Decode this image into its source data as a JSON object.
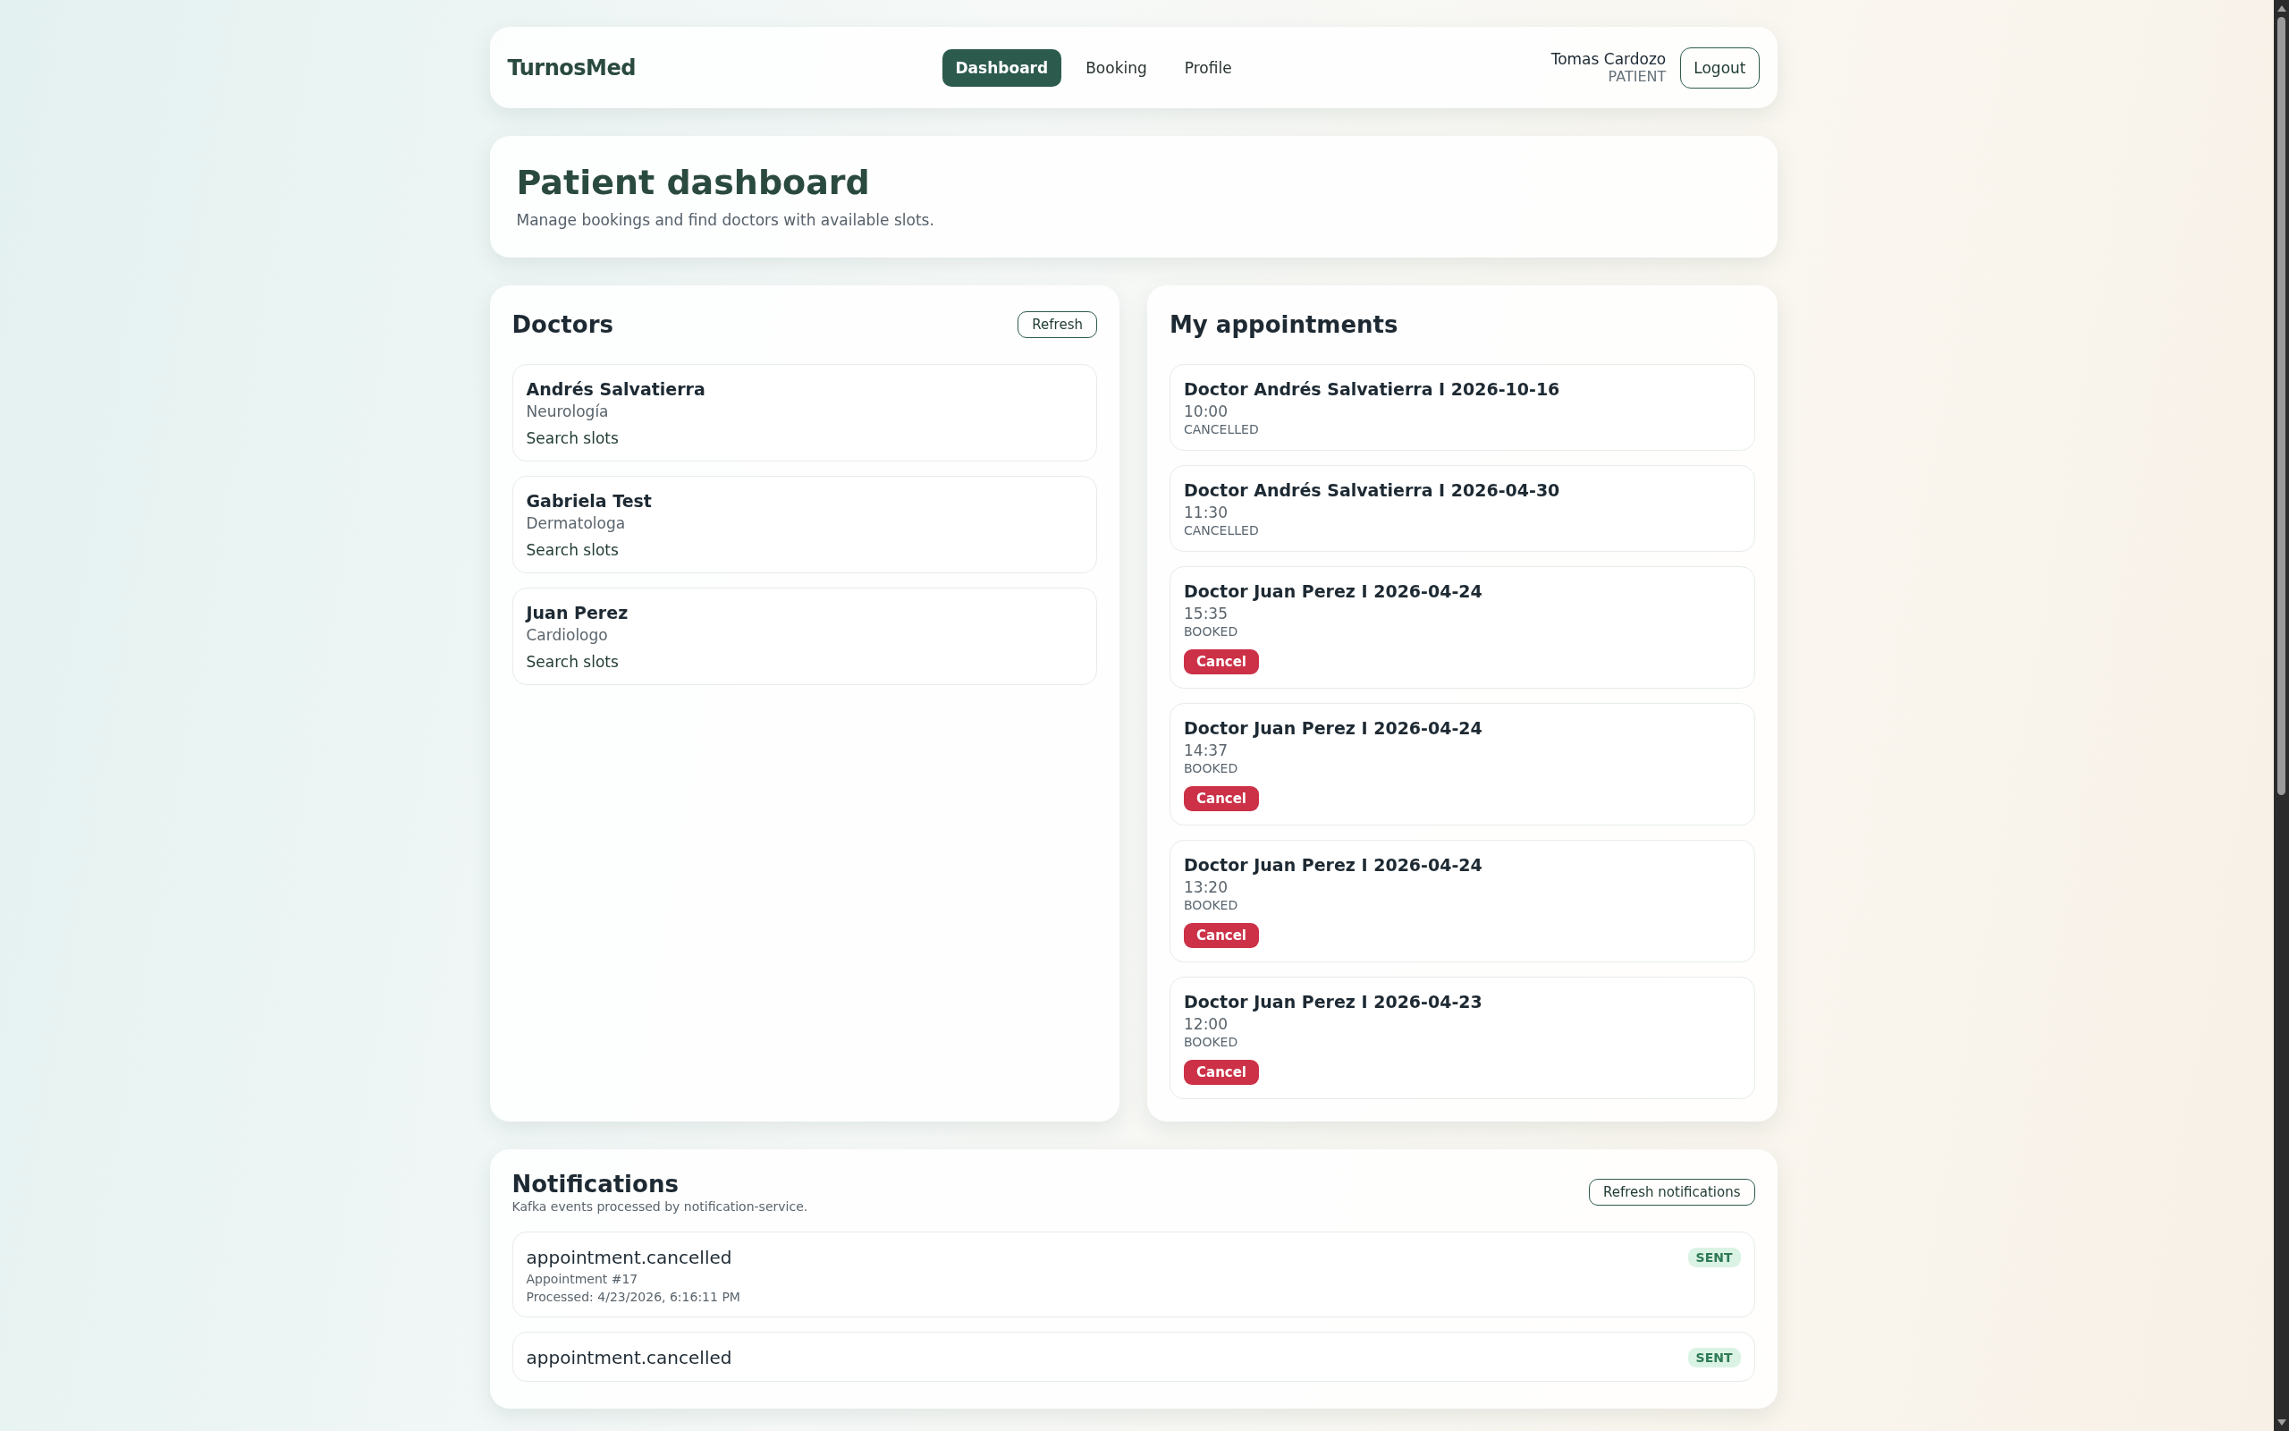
{
  "nav": {
    "logo": "TurnosMed",
    "tabs": [
      {
        "label": "Dashboard",
        "selected": true
      },
      {
        "label": "Booking",
        "selected": false
      },
      {
        "label": "Profile",
        "selected": false
      }
    ],
    "user": {
      "name": "Tomas Cardozo",
      "role": "PATIENT"
    },
    "logout": "Logout"
  },
  "hero": {
    "title": "Patient dashboard",
    "subtitle": "Manage bookings and find doctors with available slots."
  },
  "doctors": {
    "title": "Doctors",
    "refresh": "Refresh",
    "items": [
      {
        "name": "Andrés Salvatierra",
        "specialty": "Neurología",
        "action": "Search slots"
      },
      {
        "name": "Gabriela Test",
        "specialty": "Dermatologa",
        "action": "Search slots"
      },
      {
        "name": "Juan Perez",
        "specialty": "Cardiologo",
        "action": "Search slots"
      }
    ]
  },
  "appointments": {
    "title": "My appointments",
    "items": [
      {
        "title": "Doctor Andrés Salvatierra I 2026-10-16",
        "time": "10:00",
        "status": "CANCELLED"
      },
      {
        "title": "Doctor Andrés Salvatierra I 2026-04-30",
        "time": "11:30",
        "status": "CANCELLED"
      },
      {
        "title": "Doctor Juan Perez I 2026-04-24",
        "time": "15:35",
        "status": "BOOKED",
        "cancel": "Cancel"
      },
      {
        "title": "Doctor Juan Perez I 2026-04-24",
        "time": "14:37",
        "status": "BOOKED",
        "cancel": "Cancel"
      },
      {
        "title": "Doctor Juan Perez I 2026-04-24",
        "time": "13:20",
        "status": "BOOKED",
        "cancel": "Cancel"
      },
      {
        "title": "Doctor Juan Perez I 2026-04-23",
        "time": "12:00",
        "status": "BOOKED",
        "cancel": "Cancel"
      }
    ]
  },
  "notifications": {
    "title": "Notifications",
    "subtitle": "Kafka events processed by notification-service.",
    "refresh": "Refresh notifications",
    "items": [
      {
        "event": "appointment.cancelled",
        "badge": "SENT",
        "detail": "Appointment #17",
        "processed": "Processed: 4/23/2026, 6:16:11 PM"
      },
      {
        "event": "appointment.cancelled",
        "badge": "SENT"
      }
    ]
  }
}
